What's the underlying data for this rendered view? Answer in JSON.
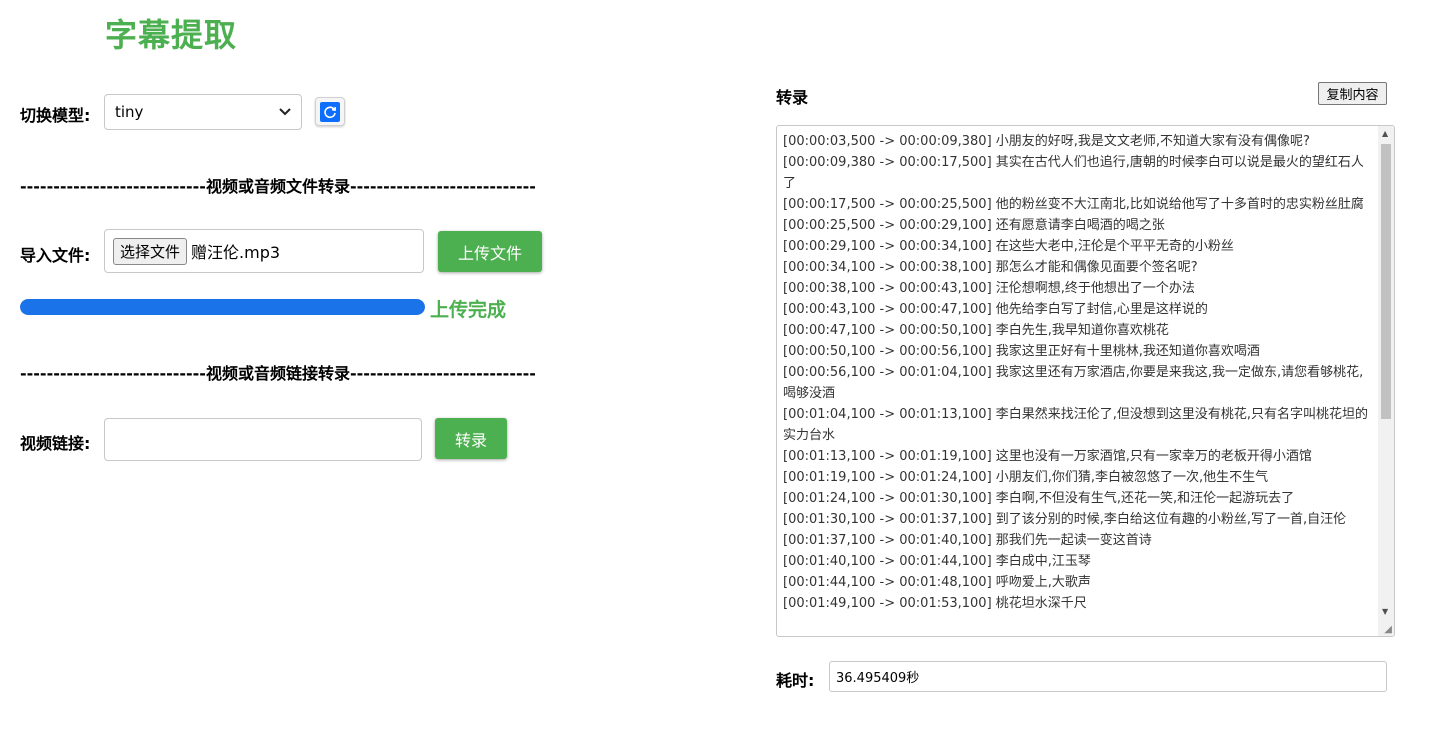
{
  "app": {
    "title": "字幕提取"
  },
  "model": {
    "label": "切换模型:",
    "selected": "tiny",
    "refresh_icon": "refresh-icon"
  },
  "file_section": {
    "divider": "----------------------------视频或音频文件转录----------------------------",
    "label": "导入文件:",
    "choose_button": "选择文件",
    "file_name": "赠汪伦.mp3",
    "upload_button": "上传文件",
    "progress_fraction": 1.0,
    "upload_status": "上传完成"
  },
  "link_section": {
    "divider": "----------------------------视频或音频链接转录----------------------------",
    "label": "视频链接:",
    "input_value": "",
    "transcribe_button": "转录"
  },
  "transcript": {
    "heading": "转录",
    "copy_button": "复制内容",
    "lines": [
      "[00:00:03,500 -> 00:00:09,380] 小朋友的好呀,我是文文老师,不知道大家有没有偶像呢?",
      "[00:00:09,380 -> 00:00:17,500] 其实在古代人们也追行,唐朝的时候李白可以说是最火的望红石人了",
      "[00:00:17,500 -> 00:00:25,500] 他的粉丝变不大江南北,比如说给他写了十多首时的忠实粉丝肚腐",
      "[00:00:25,500 -> 00:00:29,100] 还有愿意请李白喝酒的喝之张",
      "[00:00:29,100 -> 00:00:34,100] 在这些大老中,汪伦是个平平无奇的小粉丝",
      "[00:00:34,100 -> 00:00:38,100] 那怎么才能和偶像见面要个签名呢?",
      "[00:00:38,100 -> 00:00:43,100] 汪伦想啊想,终于他想出了一个办法",
      "[00:00:43,100 -> 00:00:47,100] 他先给李白写了封信,心里是这样说的",
      "[00:00:47,100 -> 00:00:50,100] 李白先生,我早知道你喜欢桃花",
      "[00:00:50,100 -> 00:00:56,100] 我家这里正好有十里桃林,我还知道你喜欢喝酒",
      "[00:00:56,100 -> 00:01:04,100] 我家这里还有万家酒店,你要是来我这,我一定做东,请您看够桃花,喝够没酒",
      "[00:01:04,100 -> 00:01:13,100] 李白果然来找汪伦了,但没想到这里没有桃花,只有名字叫桃花坦的实力台水",
      "[00:01:13,100 -> 00:01:19,100] 这里也没有一万家酒馆,只有一家幸万的老板开得小酒馆",
      "[00:01:19,100 -> 00:01:24,100] 小朋友们,你们猜,李白被忽悠了一次,他生不生气",
      "[00:01:24,100 -> 00:01:30,100] 李白啊,不但没有生气,还花一笑,和汪伦一起游玩去了",
      "[00:01:30,100 -> 00:01:37,100] 到了该分别的时候,李白给这位有趣的小粉丝,写了一首,自汪伦",
      "[00:01:37,100 -> 00:01:40,100] 那我们先一起读一变这首诗",
      "[00:01:40,100 -> 00:01:44,100] 李白成中,江玉琴",
      "[00:01:44,100 -> 00:01:48,100] 呼吻爱上,大歌声",
      "[00:01:49,100 -> 00:01:53,100] 桃花坦水深千尺"
    ]
  },
  "elapsed": {
    "label": "耗时:",
    "value": "36.495409秒"
  },
  "colors": {
    "accent_green": "#4caf50",
    "progress_blue": "#1a73e8"
  }
}
